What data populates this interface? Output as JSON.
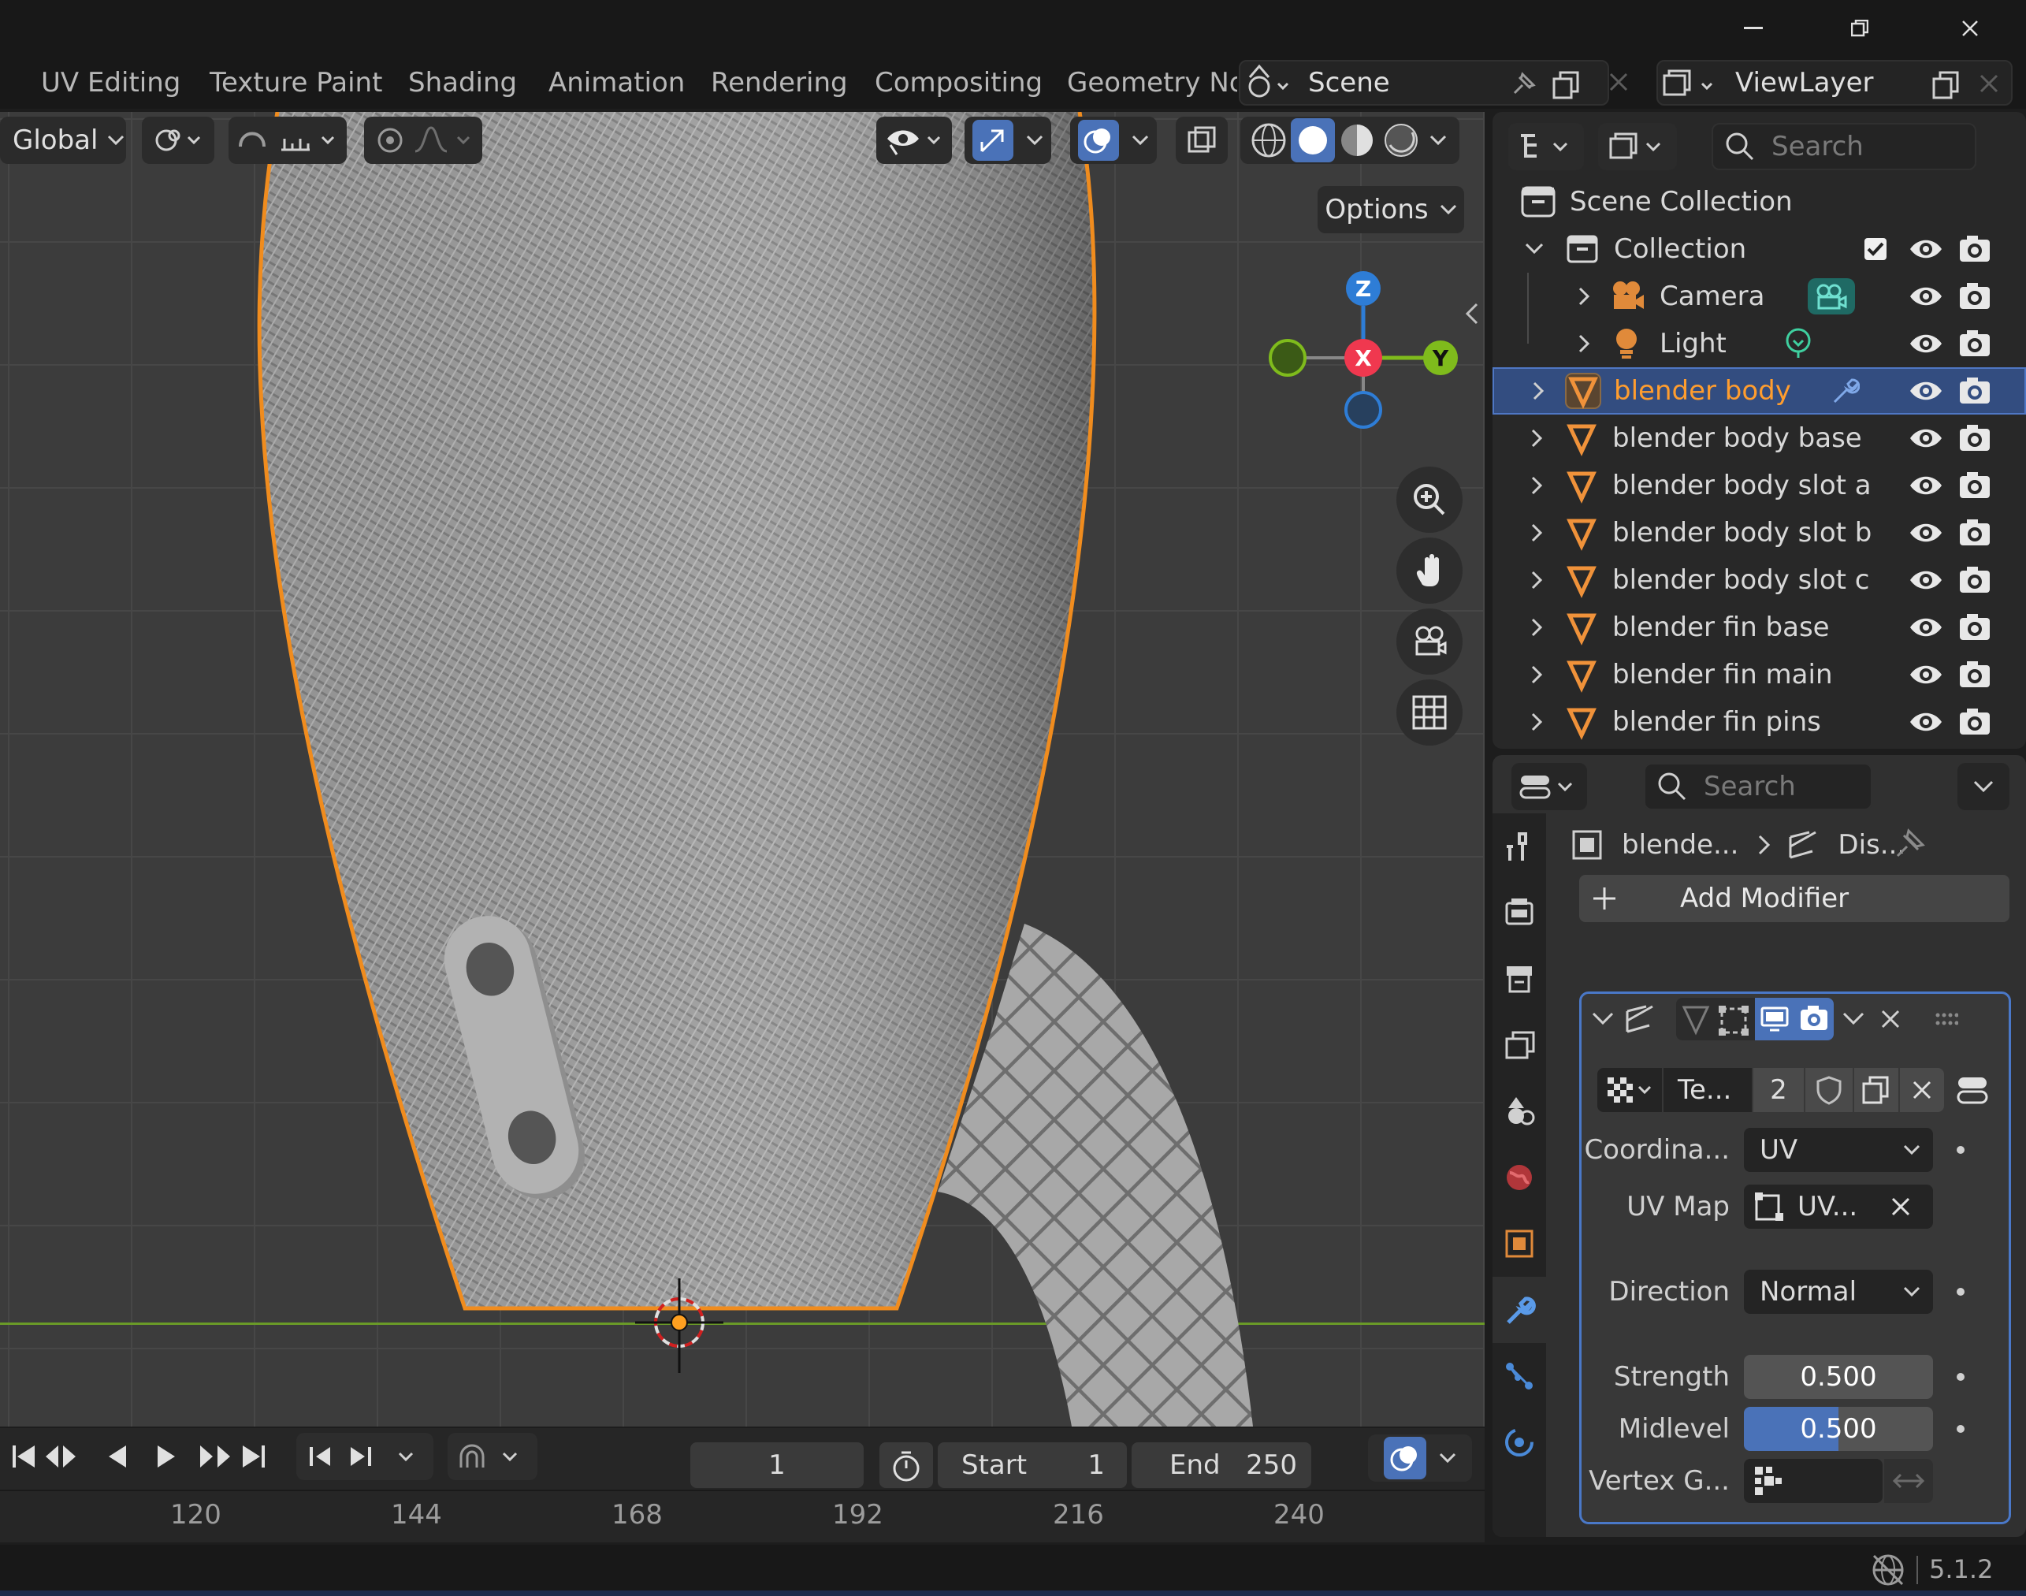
{
  "window": {
    "minimize": "—",
    "maximize": "❐",
    "close": "✕"
  },
  "workspaces": [
    "UV Editing",
    "Texture Paint",
    "Shading",
    "Animation",
    "Rendering",
    "Compositing",
    "Geometry No"
  ],
  "scene": {
    "name": "Scene"
  },
  "view_layer": {
    "name": "ViewLayer"
  },
  "viewport_header": {
    "orientation": "Global",
    "shading_mode": "solid",
    "options_label": "Options"
  },
  "gizmo": {
    "x": "X",
    "y": "Y",
    "z": "Z"
  },
  "outliner": {
    "search_placeholder": "Search",
    "scene_collection": "Scene Collection",
    "collection": "Collection",
    "objects": [
      {
        "name": "Camera",
        "type": "camera"
      },
      {
        "name": "Light",
        "type": "light"
      },
      {
        "name": "blender body",
        "type": "mesh",
        "selected": true
      },
      {
        "name": "blender body base",
        "type": "mesh"
      },
      {
        "name": "blender body slot a",
        "type": "mesh"
      },
      {
        "name": "blender body slot b",
        "type": "mesh"
      },
      {
        "name": "blender body slot c",
        "type": "mesh"
      },
      {
        "name": "blender fin base",
        "type": "mesh"
      },
      {
        "name": "blender fin main",
        "type": "mesh"
      },
      {
        "name": "blender fin pins",
        "type": "mesh"
      }
    ]
  },
  "properties": {
    "search_placeholder": "Search",
    "breadcrumb_object": "blende...",
    "breadcrumb_modifier": "Dis...",
    "add_modifier": "Add Modifier",
    "texture_name": "Te...",
    "texture_users": "2",
    "coordinates_label": "Coordina...",
    "coordinates_value": "UV",
    "uvmap_label": "UV Map",
    "uvmap_value": "UV...",
    "direction_label": "Direction",
    "direction_value": "Normal",
    "strength_label": "Strength",
    "strength_value": "0.500",
    "midlevel_label": "Midlevel",
    "midlevel_value": "0.500",
    "midlevel_fill": 0.5,
    "vertex_group_label": "Vertex G..."
  },
  "timeline": {
    "current_frame": "1",
    "start_label": "Start",
    "start_value": "1",
    "end_label": "End",
    "end_value": "250",
    "ticks": [
      "120",
      "144",
      "168",
      "192",
      "216",
      "240"
    ]
  },
  "status": {
    "version": "5.1.2"
  },
  "colors": {
    "accent": "#4a72b8",
    "selection": "#ff9d2e",
    "x_axis": "#f0384f",
    "y_axis": "#7fbb1c",
    "z_axis": "#2e7dd6"
  }
}
